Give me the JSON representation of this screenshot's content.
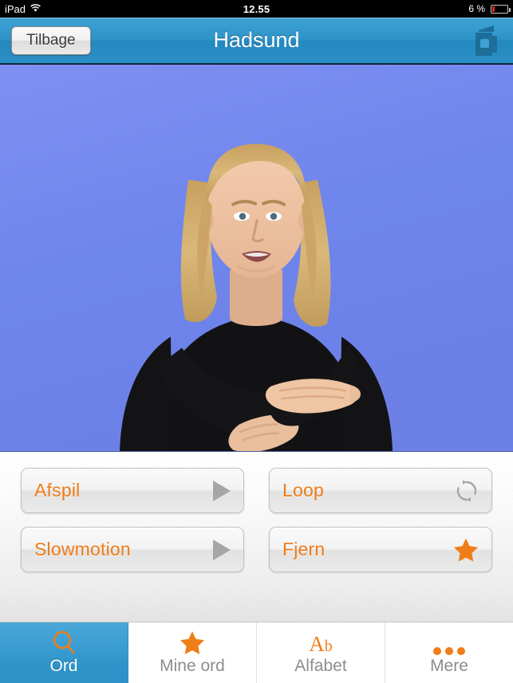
{
  "status_bar": {
    "device": "iPad",
    "wifi_icon": "wifi-icon",
    "time": "12.55",
    "battery_percent": "6 %",
    "battery_level": 6
  },
  "nav_bar": {
    "back_label": "Tilbage",
    "title": "Hadsund",
    "right_icon": "book-flip-icon",
    "background_color": "#2e93c9"
  },
  "video": {
    "description": "Sign language video of a woman signing",
    "background_color": "#6f86ec"
  },
  "controls": {
    "buttons": [
      {
        "label": "Afspil",
        "icon": "play-icon",
        "icon_color": "#a6a6a6"
      },
      {
        "label": "Loop",
        "icon": "loop-icon",
        "icon_color": "#a6a6a6"
      },
      {
        "label": "Slowmotion",
        "icon": "play-icon",
        "icon_color": "#a6a6a6"
      },
      {
        "label": "Fjern",
        "icon": "star-icon",
        "icon_color": "#ef7d18"
      }
    ],
    "text_color": "#ee7b17"
  },
  "tab_bar": {
    "tabs": [
      {
        "label": "Ord",
        "icon": "search-icon",
        "active": true
      },
      {
        "label": "Mine ord",
        "icon": "star-icon",
        "active": false
      },
      {
        "label": "Alfabet",
        "icon": "ab-text-icon",
        "active": false
      },
      {
        "label": "Mere",
        "icon": "ellipsis-icon",
        "active": false
      }
    ],
    "active_color": "#2e93c9",
    "icon_color": "#ef7d18",
    "inactive_label_color": "#8d8d8d"
  }
}
